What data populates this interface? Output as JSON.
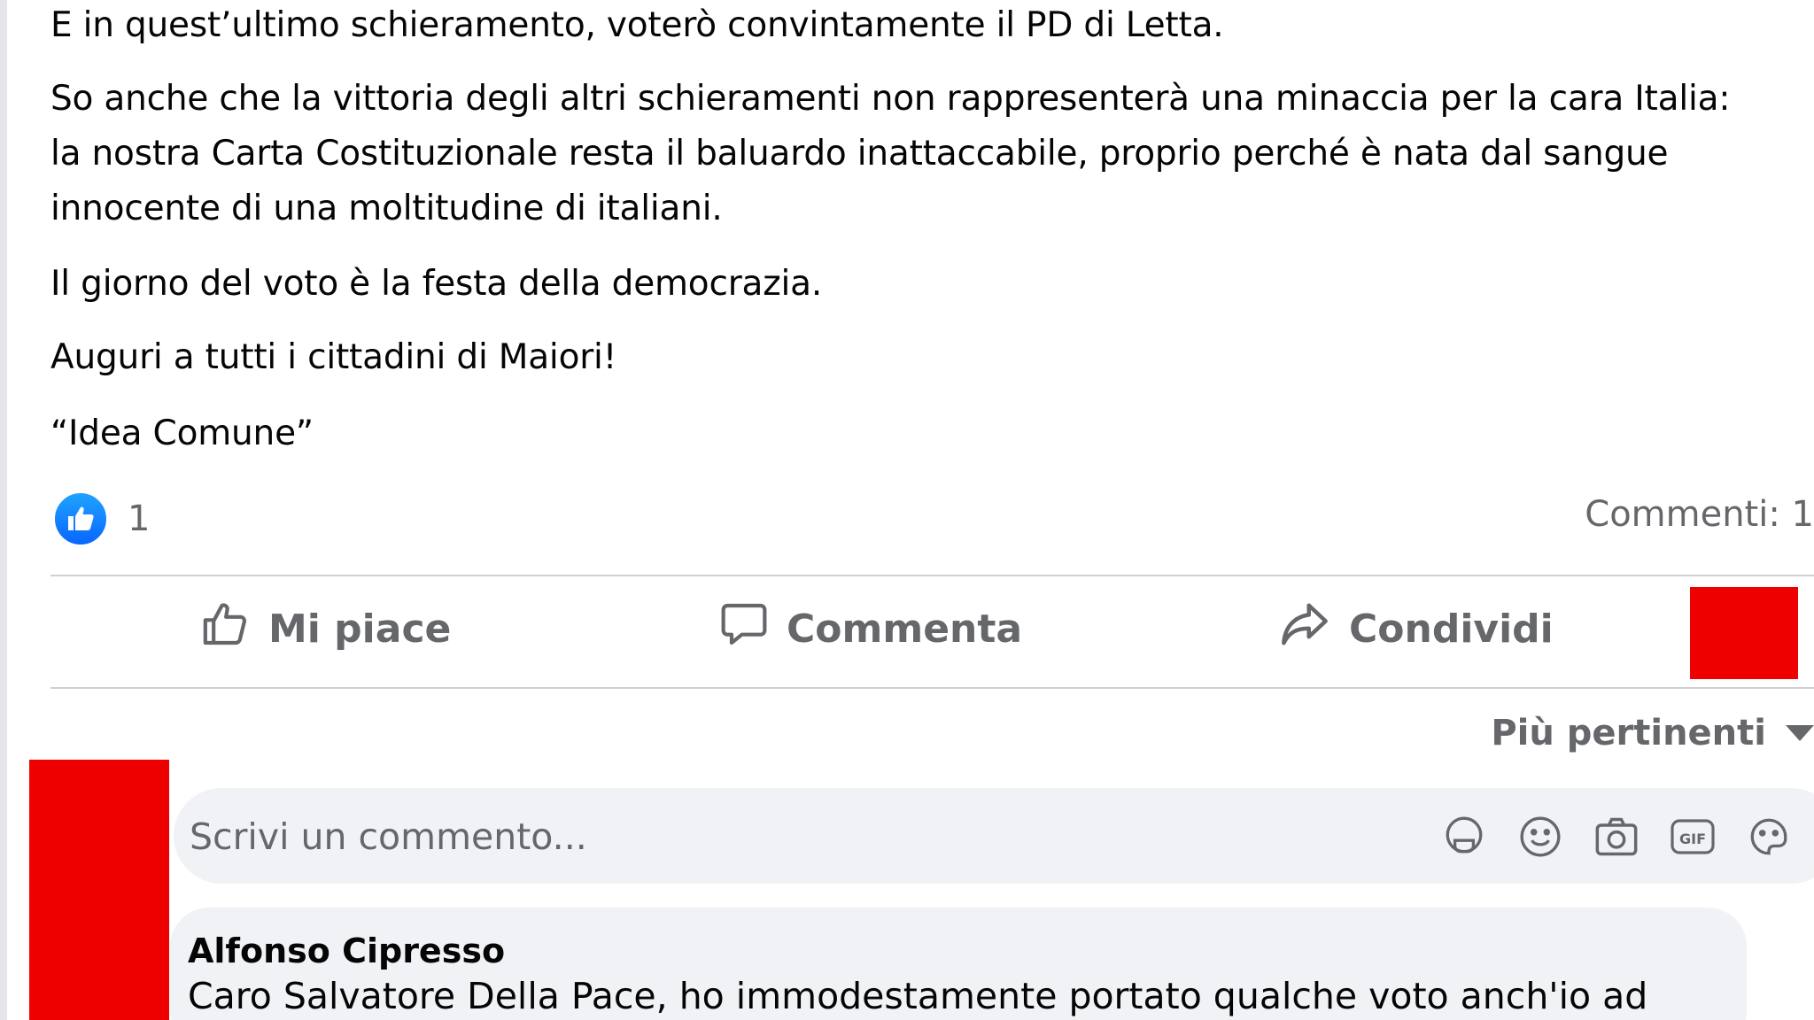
{
  "post": {
    "paragraphs": {
      "p1_pre": "E in quest’ultimo schieramento, ",
      "p1_highlight": "voterò convintamente il PD di Letta.",
      "p2_line1": "So anche che la vittoria degli altri schieramenti non rappresenterà una minaccia per la cara Italia:",
      "p2_line2": "la nostra Carta Costituzionale resta il baluardo inattaccabile, proprio perché è nata dal sangue",
      "p2_line3": "innocente di una moltitudine di italiani.",
      "p3": "Il giorno del voto è la festa della democrazia.",
      "p4": "Auguri a tutti i cittadini di Maiori!",
      "signature": "“Idea Comune”"
    },
    "reactions": {
      "like_icon": "thumbs-up-icon",
      "count": "1"
    },
    "comments_count": "Commenti: 1"
  },
  "actions": {
    "like": {
      "label": "Mi piace",
      "icon": "thumbs-up-outline-icon"
    },
    "comment": {
      "label": "Commenta",
      "icon": "speech-bubble-icon"
    },
    "share": {
      "label": "Condividi",
      "icon": "share-arrow-icon"
    }
  },
  "sort": {
    "label": "Più pertinenti"
  },
  "comment_box": {
    "placeholder": "Scrivi un commento...",
    "icons": [
      "avatar-sticker-icon",
      "emoji-icon",
      "camera-icon",
      "gif-icon",
      "sticker-icon"
    ]
  },
  "comments": [
    {
      "author": "Alfonso Cipresso",
      "text": "Caro Salvatore Della Pace, ho immodestamente portato qualche voto anch'io ad"
    }
  ],
  "colors": {
    "accent": "#0866ff",
    "redaction": "#ee0000",
    "highlight_underline": "#f6858a",
    "muted_text": "#65676b"
  }
}
